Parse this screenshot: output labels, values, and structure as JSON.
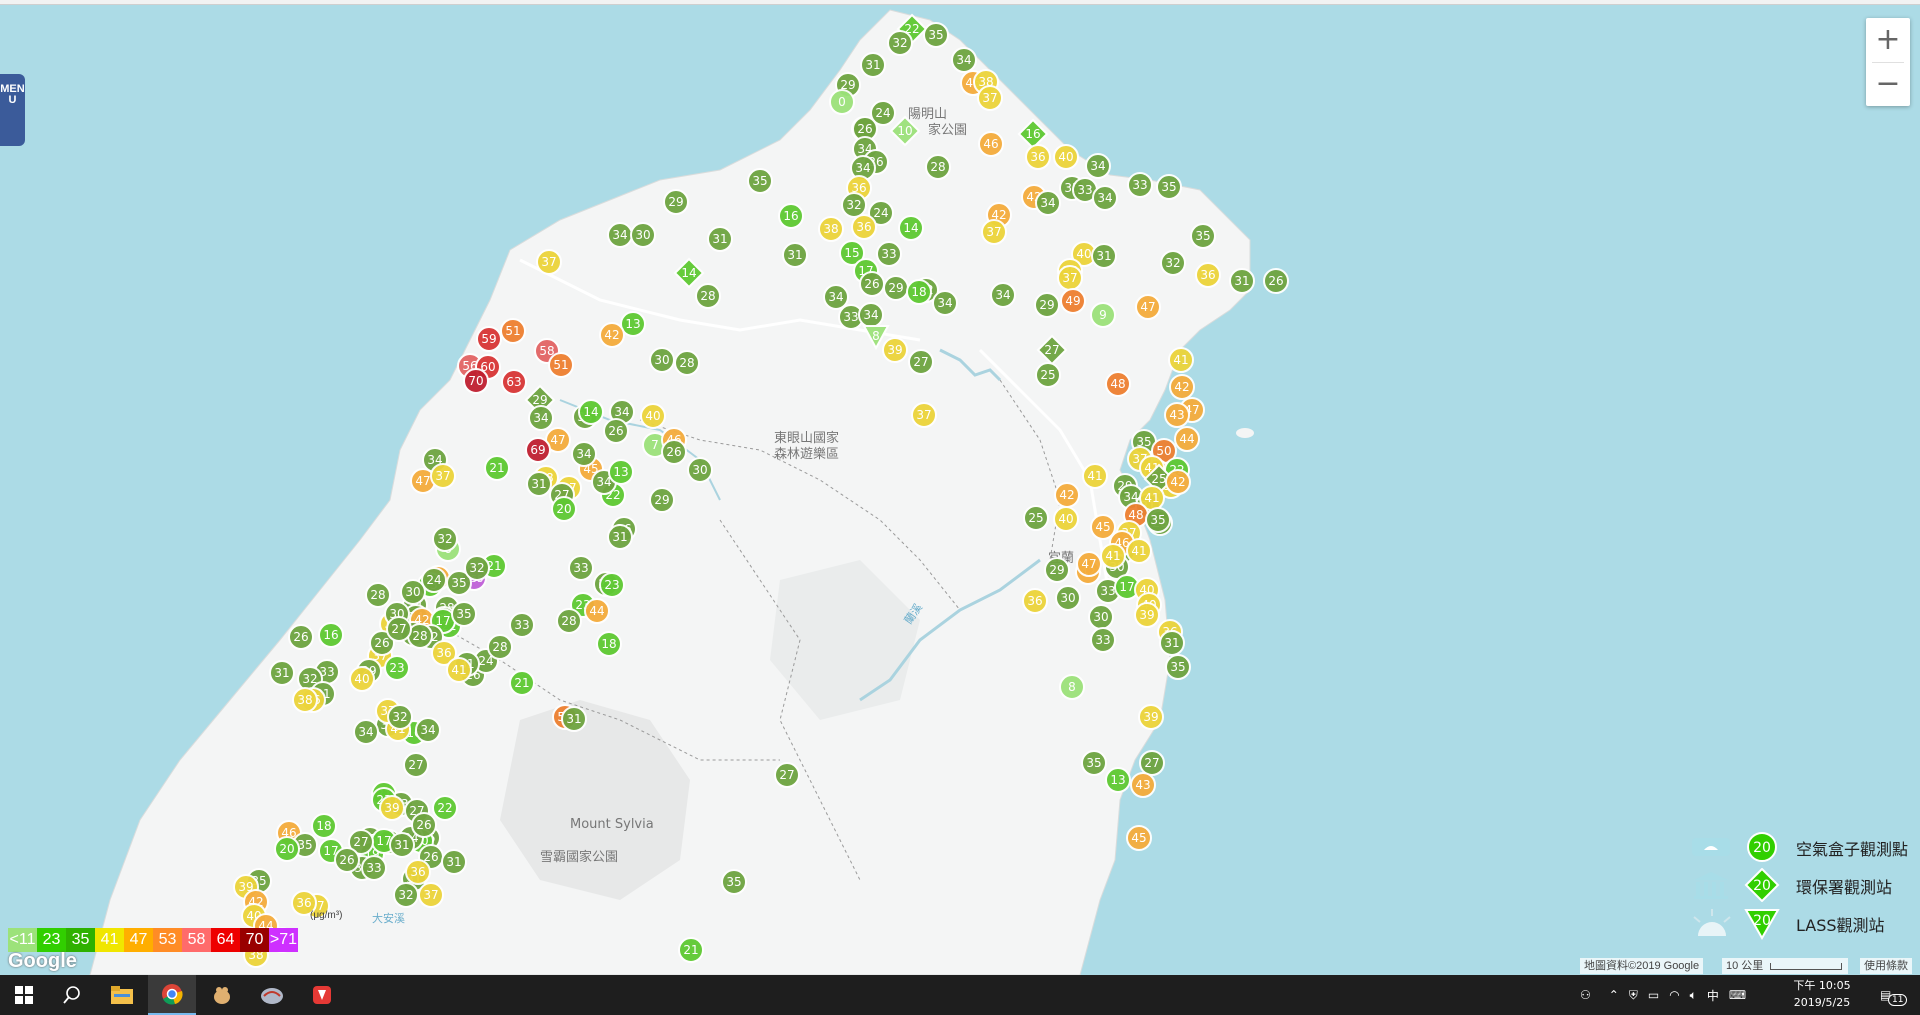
{
  "menu_label": "MENU",
  "zoom": {
    "in_label": "+",
    "out_label": "−"
  },
  "map_labels": [
    {
      "text": "陽明山"
    },
    {
      "text": "家公園"
    },
    {
      "text": "東眼山國家"
    },
    {
      "text": "森林遊樂區"
    },
    {
      "text": "宜蘭"
    },
    {
      "text": "Mount Sylvia"
    },
    {
      "text": "雪霸國家公園"
    },
    {
      "text": "蘭溪"
    },
    {
      "text": "大安溪"
    }
  ],
  "scale": {
    "unit": "(μg/m³)",
    "items": [
      {
        "label": "<11",
        "color": "#9ce27a"
      },
      {
        "label": "23",
        "color": "#31cf00"
      },
      {
        "label": "35",
        "color": "#2eb100"
      },
      {
        "label": "41",
        "color": "#f0e600"
      },
      {
        "label": "47",
        "color": "#ffae00"
      },
      {
        "label": "53",
        "color": "#ff8c26"
      },
      {
        "label": "58",
        "color": "#ff6b6b"
      },
      {
        "label": "64",
        "color": "#ee0000"
      },
      {
        "label": "70",
        "color": "#990000"
      },
      {
        "label": ">71",
        "color": "#ce30ff"
      }
    ]
  },
  "legend": {
    "sample_value": "20",
    "items": [
      {
        "label": "空氣盒子觀測點",
        "shape": "circle",
        "icon": "airbox-icon"
      },
      {
        "label": "環保署觀測站",
        "shape": "diamond",
        "icon": "government-building-icon"
      },
      {
        "label": "LASS觀測站",
        "shape": "triangle",
        "icon": "sun-icon"
      }
    ]
  },
  "attribution": {
    "map_data": "地圖資料©2019 Google",
    "scale": "10 公里",
    "terms": "使用條款"
  },
  "google_logo": "Google",
  "markers": [
    {
      "v": "22",
      "s": "d"
    },
    {
      "v": "32",
      "s": "c"
    },
    {
      "v": "35",
      "s": "c"
    },
    {
      "v": "31",
      "s": "c"
    },
    {
      "v": "34",
      "s": "c"
    },
    {
      "v": "29",
      "s": "c"
    },
    {
      "v": "46",
      "s": "c"
    },
    {
      "v": "38",
      "s": "c"
    },
    {
      "v": "37",
      "s": "c"
    },
    {
      "v": "0",
      "s": "c"
    },
    {
      "v": "24",
      "s": "c"
    },
    {
      "v": "31",
      "s": "c"
    },
    {
      "v": "26",
      "s": "c"
    },
    {
      "v": "10",
      "s": "d"
    },
    {
      "v": "16",
      "s": "d"
    },
    {
      "v": "46",
      "s": "c"
    },
    {
      "v": "34",
      "s": "c"
    },
    {
      "v": "36",
      "s": "c"
    },
    {
      "v": "40",
      "s": "c"
    },
    {
      "v": "26",
      "s": "c"
    },
    {
      "v": "34",
      "s": "c"
    },
    {
      "v": "28",
      "s": "c"
    },
    {
      "v": "35",
      "s": "c"
    },
    {
      "v": "34",
      "s": "c"
    },
    {
      "v": "36",
      "s": "c"
    },
    {
      "v": "33",
      "s": "c"
    },
    {
      "v": "35",
      "s": "c"
    },
    {
      "v": "29",
      "s": "c"
    },
    {
      "v": "16",
      "s": "c"
    },
    {
      "v": "32",
      "s": "c"
    },
    {
      "v": "24",
      "s": "c"
    },
    {
      "v": "42",
      "s": "c"
    },
    {
      "v": "34",
      "s": "c"
    },
    {
      "v": "35",
      "s": "c"
    },
    {
      "v": "33",
      "s": "c"
    },
    {
      "v": "34",
      "s": "c"
    },
    {
      "v": "38",
      "s": "c"
    },
    {
      "v": "36",
      "s": "c"
    },
    {
      "v": "14",
      "s": "c"
    },
    {
      "v": "42",
      "s": "c"
    },
    {
      "v": "37",
      "s": "c"
    },
    {
      "v": "34",
      "s": "c"
    },
    {
      "v": "30",
      "s": "c"
    },
    {
      "v": "31",
      "s": "c"
    },
    {
      "v": "31",
      "s": "c"
    },
    {
      "v": "15",
      "s": "c"
    },
    {
      "v": "33",
      "s": "c"
    },
    {
      "v": "35",
      "s": "c"
    },
    {
      "v": "37",
      "s": "c"
    },
    {
      "v": "14",
      "s": "d"
    },
    {
      "v": "17",
      "s": "c"
    },
    {
      "v": "32",
      "s": "c"
    },
    {
      "v": "29",
      "s": "c"
    },
    {
      "v": "26",
      "s": "c"
    },
    {
      "v": "34",
      "s": "c"
    },
    {
      "v": "18",
      "s": "c"
    },
    {
      "v": "34",
      "s": "c"
    },
    {
      "v": "40",
      "s": "c"
    },
    {
      "v": "36",
      "s": "c"
    },
    {
      "v": "31",
      "s": "c"
    },
    {
      "v": "37",
      "s": "c"
    },
    {
      "v": "32",
      "s": "c"
    },
    {
      "v": "36",
      "s": "c"
    },
    {
      "v": "31",
      "s": "c"
    },
    {
      "v": "26",
      "s": "c"
    },
    {
      "v": "34",
      "s": "c"
    },
    {
      "v": "28",
      "s": "c"
    },
    {
      "v": "33",
      "s": "c"
    },
    {
      "v": "34",
      "s": "c"
    },
    {
      "v": "51",
      "s": "c"
    },
    {
      "v": "59",
      "s": "c"
    },
    {
      "v": "56",
      "s": "c"
    },
    {
      "v": "60",
      "s": "c"
    },
    {
      "v": "70",
      "s": "c"
    },
    {
      "v": "58",
      "s": "c"
    },
    {
      "v": "51",
      "s": "c"
    },
    {
      "v": "29",
      "s": "d"
    },
    {
      "v": "63",
      "s": "c"
    },
    {
      "v": "34",
      "s": "c"
    },
    {
      "v": "35",
      "s": "c"
    },
    {
      "v": "13",
      "s": "c"
    },
    {
      "v": "28",
      "s": "c"
    },
    {
      "v": "8",
      "s": "t"
    },
    {
      "v": "27",
      "s": "c"
    },
    {
      "v": "39",
      "s": "c"
    },
    {
      "v": "42",
      "s": "c"
    },
    {
      "v": "30",
      "s": "c"
    },
    {
      "v": "37",
      "s": "c"
    },
    {
      "v": "29",
      "s": "c"
    },
    {
      "v": "9",
      "s": "c"
    },
    {
      "v": "49",
      "s": "c"
    },
    {
      "v": "47",
      "s": "c"
    },
    {
      "v": "48",
      "s": "c"
    },
    {
      "v": "27",
      "s": "d"
    },
    {
      "v": "25",
      "s": "c"
    },
    {
      "v": "47",
      "s": "c"
    },
    {
      "v": "14",
      "s": "c"
    },
    {
      "v": "34",
      "s": "c"
    },
    {
      "v": "26",
      "s": "c"
    },
    {
      "v": "7",
      "s": "c"
    },
    {
      "v": "40",
      "s": "c"
    },
    {
      "v": "46",
      "s": "c"
    },
    {
      "v": "47",
      "s": "c"
    },
    {
      "v": "35",
      "s": "c"
    },
    {
      "v": "50",
      "s": "c"
    },
    {
      "v": "44",
      "s": "c"
    },
    {
      "v": "22",
      "s": "c"
    },
    {
      "v": "39",
      "s": "c"
    },
    {
      "v": "29",
      "s": "c"
    },
    {
      "v": "34",
      "s": "c"
    },
    {
      "v": "47",
      "s": "c"
    },
    {
      "v": "37",
      "s": "c"
    },
    {
      "v": "21",
      "s": "c"
    },
    {
      "v": "69",
      "s": "c"
    },
    {
      "v": "38",
      "s": "c"
    },
    {
      "v": "45",
      "s": "c"
    },
    {
      "v": "31",
      "s": "c"
    },
    {
      "v": "37",
      "s": "c"
    },
    {
      "v": "22",
      "s": "c"
    },
    {
      "v": "26",
      "s": "c"
    },
    {
      "v": "34",
      "s": "c"
    },
    {
      "v": "27",
      "s": "c"
    },
    {
      "v": "20",
      "s": "c"
    },
    {
      "v": "13",
      "s": "c"
    },
    {
      "v": "34",
      "s": "c"
    },
    {
      "v": "29",
      "s": "c"
    },
    {
      "v": "26",
      "s": "c"
    },
    {
      "v": "30",
      "s": "c"
    },
    {
      "v": "34",
      "s": "c"
    },
    {
      "v": "25",
      "s": "c"
    },
    {
      "v": "32",
      "s": "c"
    },
    {
      "v": "31",
      "s": "c"
    },
    {
      "v": "45",
      "s": "c"
    },
    {
      "v": "40",
      "s": "c"
    },
    {
      "v": "30",
      "s": "c"
    },
    {
      "v": "33",
      "s": "c"
    },
    {
      "v": "30",
      "s": "c"
    },
    {
      "v": "29",
      "s": "c"
    },
    {
      "v": "17",
      "s": "c"
    },
    {
      "v": "28",
      "s": "c"
    },
    {
      "v": "24",
      "s": "c"
    },
    {
      "v": "24",
      "s": "c"
    },
    {
      "v": "34",
      "s": "c"
    },
    {
      "v": "155",
      "s": "c"
    },
    {
      "v": "21",
      "s": "c"
    },
    {
      "v": "43",
      "s": "c"
    },
    {
      "v": "35",
      "s": "c"
    },
    {
      "v": "32",
      "s": "c"
    },
    {
      "v": "42",
      "s": "c"
    },
    {
      "v": "22",
      "s": "c"
    },
    {
      "v": "23",
      "s": "c"
    },
    {
      "v": "30",
      "s": "c"
    },
    {
      "v": "26",
      "s": "c"
    },
    {
      "v": "24",
      "s": "c"
    },
    {
      "v": "31",
      "s": "c"
    },
    {
      "v": "6",
      "s": "c"
    },
    {
      "v": "17",
      "s": "c"
    },
    {
      "v": "32",
      "s": "c"
    },
    {
      "v": "38",
      "s": "c"
    },
    {
      "v": "29",
      "s": "c"
    },
    {
      "v": "32",
      "s": "c"
    },
    {
      "v": "33",
      "s": "c"
    },
    {
      "v": "31",
      "s": "c"
    },
    {
      "v": "33",
      "s": "c"
    },
    {
      "v": "29",
      "s": "c"
    },
    {
      "v": "23",
      "s": "c"
    },
    {
      "v": "28",
      "s": "c"
    },
    {
      "v": "28",
      "s": "c"
    },
    {
      "v": "23",
      "s": "c"
    },
    {
      "v": "44",
      "s": "c"
    },
    {
      "v": "18",
      "s": "c"
    },
    {
      "v": "35",
      "s": "c"
    },
    {
      "v": "36",
      "s": "c"
    },
    {
      "v": "28",
      "s": "c"
    },
    {
      "v": "37",
      "s": "c"
    },
    {
      "v": "29",
      "s": "c"
    },
    {
      "v": "26",
      "s": "c"
    },
    {
      "v": "28",
      "s": "c"
    },
    {
      "v": "30",
      "s": "c"
    },
    {
      "v": "24",
      "s": "c"
    },
    {
      "v": "16",
      "s": "c"
    },
    {
      "v": "26",
      "s": "c"
    },
    {
      "v": "33",
      "s": "c"
    },
    {
      "v": "32",
      "s": "c"
    },
    {
      "v": "31",
      "s": "c"
    },
    {
      "v": "27",
      "s": "c"
    },
    {
      "v": "23",
      "s": "c"
    },
    {
      "v": "31",
      "s": "c"
    },
    {
      "v": "36",
      "s": "c"
    },
    {
      "v": "38",
      "s": "c"
    },
    {
      "v": "40",
      "s": "c"
    },
    {
      "v": "32",
      "s": "c"
    },
    {
      "v": "16",
      "s": "c"
    },
    {
      "v": "41",
      "s": "c"
    },
    {
      "v": "34",
      "s": "c"
    },
    {
      "v": "37",
      "s": "c"
    },
    {
      "v": "32",
      "s": "c"
    },
    {
      "v": "34",
      "s": "c"
    },
    {
      "v": "41",
      "s": "c"
    },
    {
      "v": "21",
      "s": "c"
    },
    {
      "v": "51",
      "s": "c"
    },
    {
      "v": "31",
      "s": "c"
    },
    {
      "v": "21",
      "s": "c"
    },
    {
      "v": "27",
      "s": "c"
    },
    {
      "v": "33",
      "s": "c"
    },
    {
      "v": "27",
      "s": "c"
    },
    {
      "v": "22",
      "s": "c"
    },
    {
      "v": "23",
      "s": "c"
    },
    {
      "v": "25",
      "s": "c"
    },
    {
      "v": "35",
      "s": "c"
    },
    {
      "v": "19",
      "s": "c"
    },
    {
      "v": "39",
      "s": "c"
    },
    {
      "v": "46",
      "s": "c"
    },
    {
      "v": "35",
      "s": "c"
    },
    {
      "v": "20",
      "s": "c"
    },
    {
      "v": "18",
      "s": "c"
    },
    {
      "v": "35",
      "s": "c"
    },
    {
      "v": "17",
      "s": "c"
    },
    {
      "v": "28",
      "s": "c"
    },
    {
      "v": "20",
      "s": "c"
    },
    {
      "v": "34",
      "s": "c"
    },
    {
      "v": "26",
      "s": "c"
    },
    {
      "v": "17",
      "s": "c"
    },
    {
      "v": "27",
      "s": "c"
    },
    {
      "v": "31",
      "s": "c"
    },
    {
      "v": "37",
      "s": "c"
    },
    {
      "v": "36",
      "s": "c"
    },
    {
      "v": "26",
      "s": "c"
    },
    {
      "v": "33",
      "s": "c"
    },
    {
      "v": "31",
      "s": "c"
    },
    {
      "v": "26",
      "s": "c"
    },
    {
      "v": "31",
      "s": "c"
    },
    {
      "v": "37",
      "s": "c"
    },
    {
      "v": "36",
      "s": "c"
    },
    {
      "v": "32",
      "s": "c"
    },
    {
      "v": "35",
      "s": "c"
    },
    {
      "v": "39",
      "s": "c"
    },
    {
      "v": "42",
      "s": "c"
    },
    {
      "v": "40",
      "s": "c"
    },
    {
      "v": "44",
      "s": "c"
    },
    {
      "v": "42",
      "s": "c"
    },
    {
      "v": "38",
      "s": "c"
    },
    {
      "v": "41",
      "s": "c"
    },
    {
      "v": "42",
      "s": "c"
    },
    {
      "v": "43",
      "s": "c"
    },
    {
      "v": "44",
      "s": "c"
    },
    {
      "v": "37",
      "s": "c"
    },
    {
      "v": "41",
      "s": "c"
    },
    {
      "v": "25",
      "s": "d"
    },
    {
      "v": "42",
      "s": "c"
    },
    {
      "v": "41",
      "s": "c"
    },
    {
      "v": "42",
      "s": "c"
    },
    {
      "v": "41",
      "s": "c"
    },
    {
      "v": "26",
      "s": "c"
    },
    {
      "v": "48",
      "s": "c"
    },
    {
      "v": "37",
      "s": "c"
    },
    {
      "v": "46",
      "s": "c"
    },
    {
      "v": "41",
      "s": "c"
    },
    {
      "v": "35",
      "s": "c"
    },
    {
      "v": "42",
      "s": "c"
    },
    {
      "v": "40",
      "s": "c"
    },
    {
      "v": "40",
      "s": "c"
    },
    {
      "v": "41",
      "s": "c"
    },
    {
      "v": "47",
      "s": "c"
    },
    {
      "v": "39",
      "s": "c"
    },
    {
      "v": "30",
      "s": "c"
    },
    {
      "v": "33",
      "s": "c"
    },
    {
      "v": "36",
      "s": "c"
    },
    {
      "v": "31",
      "s": "c"
    },
    {
      "v": "35",
      "s": "c"
    },
    {
      "v": "39",
      "s": "c"
    },
    {
      "v": "27",
      "s": "c"
    },
    {
      "v": "43",
      "s": "c"
    },
    {
      "v": "35",
      "s": "c"
    },
    {
      "v": "45",
      "s": "c"
    },
    {
      "v": "36",
      "s": "c"
    },
    {
      "v": "8",
      "s": "c"
    },
    {
      "v": "13",
      "s": "c"
    },
    {
      "v": "27",
      "s": "c"
    },
    {
      "v": "16",
      "s": "c"
    },
    {
      "v": "21",
      "s": "c"
    },
    {
      "v": "35",
      "s": "c"
    }
  ],
  "taskbar": {
    "icons": [
      "windows-start-icon",
      "search-icon",
      "file-explorer-icon",
      "chrome-icon",
      "app-icon",
      "app-icon-2",
      "app-icon-3"
    ],
    "time": "下午 10:05",
    "date": "2019/5/25",
    "ime": "中",
    "notification_count": "11"
  }
}
